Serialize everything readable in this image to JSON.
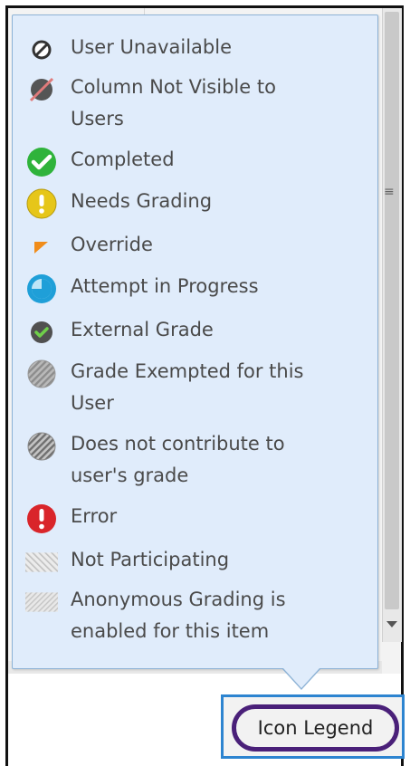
{
  "legend": {
    "items": [
      {
        "icon": "user-unavailable-icon",
        "label": "User Unavailable"
      },
      {
        "icon": "column-not-visible-icon",
        "label": "Column Not Visible to\nUsers"
      },
      {
        "icon": "completed-icon",
        "label": "Completed"
      },
      {
        "icon": "needs-grading-icon",
        "label": "Needs Grading"
      },
      {
        "icon": "override-icon",
        "label": "Override"
      },
      {
        "icon": "attempt-in-progress-icon",
        "label": "Attempt in Progress"
      },
      {
        "icon": "external-grade-icon",
        "label": "External Grade"
      },
      {
        "icon": "grade-exempted-icon",
        "label": "Grade Exempted for this\nUser"
      },
      {
        "icon": "does-not-contribute-icon",
        "label": "Does not contribute to\nuser's grade"
      },
      {
        "icon": "error-icon",
        "label": "Error"
      },
      {
        "icon": "not-participating-icon",
        "label": "Not Participating"
      },
      {
        "icon": "anonymous-grading-icon",
        "label": "Anonymous Grading is\nenabled for this item"
      }
    ]
  },
  "button": {
    "label": "Icon Legend"
  },
  "colors": {
    "popup_bg": "#e0ecfb",
    "popup_border": "#8eb3d6",
    "completed": "#2fb33b",
    "needs_grading": "#e6c619",
    "attempt": "#1f9fd8",
    "error": "#d9252a",
    "override": "#f08c1a",
    "highlight_ring": "#4a2079",
    "highlight_box": "#2d84d0"
  }
}
